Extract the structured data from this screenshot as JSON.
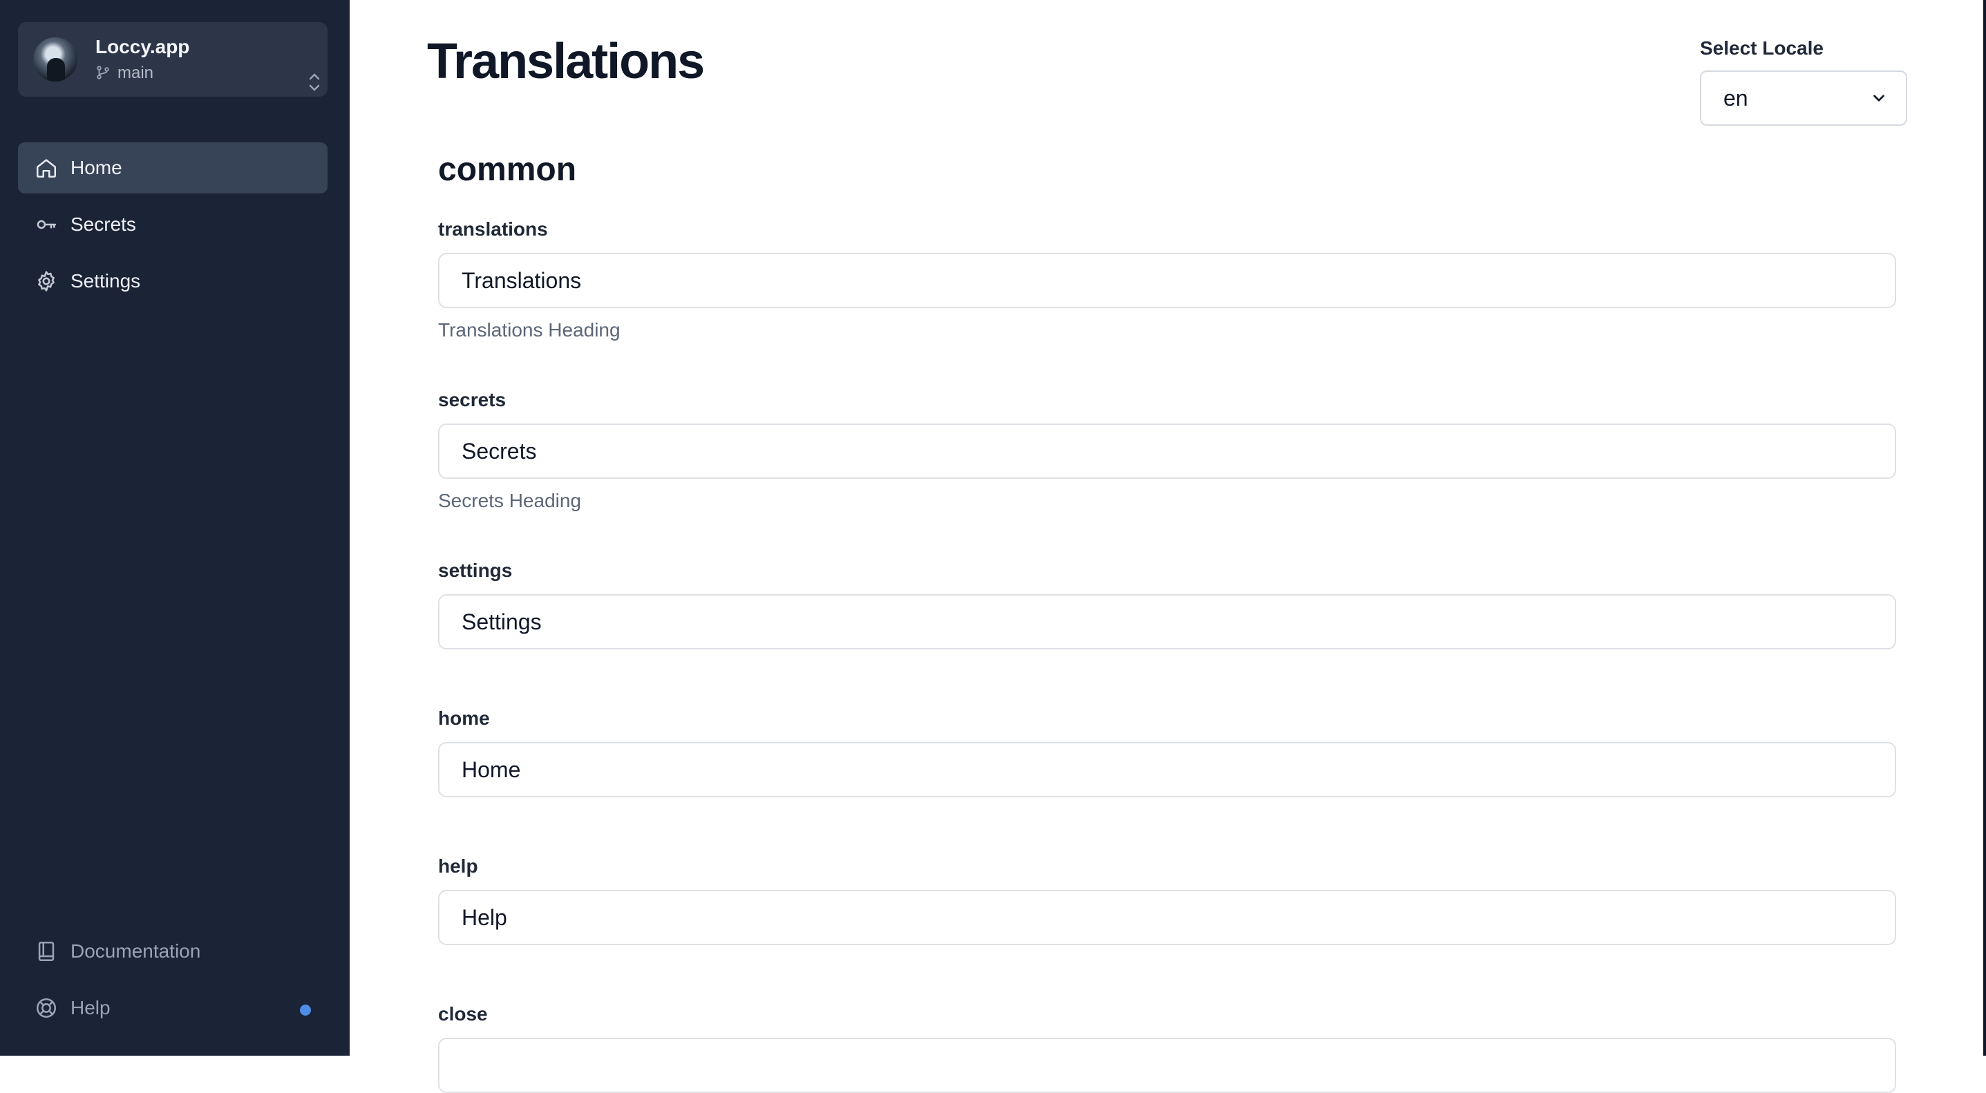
{
  "project": {
    "name": "Loccy.app",
    "branch": "main"
  },
  "nav": [
    {
      "label": "Home",
      "icon": "home-icon",
      "active": true
    },
    {
      "label": "Secrets",
      "icon": "key-icon"
    },
    {
      "label": "Settings",
      "icon": "gear-icon"
    }
  ],
  "nav_bottom": [
    {
      "label": "Documentation",
      "icon": "book-icon"
    },
    {
      "label": "Help",
      "icon": "lifebuoy-icon",
      "notification": true
    }
  ],
  "page": {
    "title": "Translations"
  },
  "locale": {
    "label": "Select Locale",
    "value": "en"
  },
  "section": {
    "title": "common"
  },
  "fields": [
    {
      "key": "translations",
      "value": "Translations",
      "help": "Translations Heading"
    },
    {
      "key": "secrets",
      "value": "Secrets",
      "help": "Secrets Heading"
    },
    {
      "key": "settings",
      "value": "Settings"
    },
    {
      "key": "home",
      "value": "Home"
    },
    {
      "key": "help",
      "value": "Help"
    },
    {
      "key": "close",
      "value": ""
    }
  ],
  "colors": {
    "sidebar_bg": "#1b2336",
    "active_nav_bg": "#374357",
    "notification_dot": "#4f8de6"
  }
}
